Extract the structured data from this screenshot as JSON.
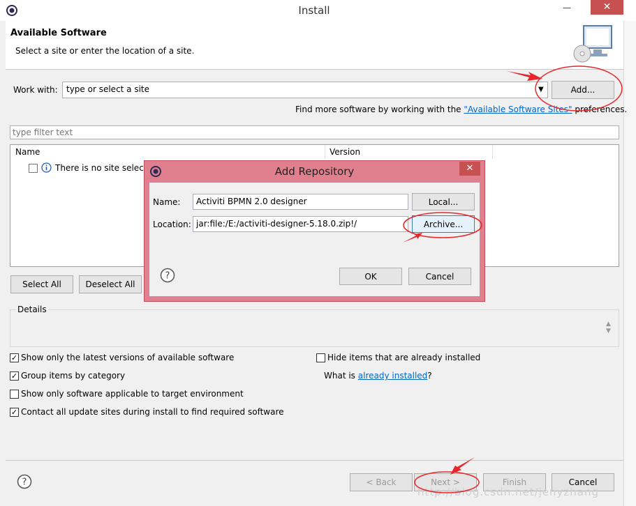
{
  "window": {
    "title": "Install",
    "minimize_glyph": "—",
    "close_glyph": "✕"
  },
  "header": {
    "title": "Available Software",
    "subtitle": "Select a site or enter the location of a site."
  },
  "work_with": {
    "label": "Work with:",
    "value": "type or select a site",
    "add_label": "Add..."
  },
  "find_more": {
    "prefix": "Find more software by working with the ",
    "link": "\"Available Software Sites\"",
    "suffix": " preferences."
  },
  "filter": {
    "placeholder": "type filter text"
  },
  "table": {
    "columns": [
      "Name",
      "Version"
    ],
    "rows": [
      {
        "text": "There is no site select"
      }
    ]
  },
  "buttons": {
    "select_all": "Select All",
    "deselect_all": "Deselect All",
    "back": "< Back",
    "next": "Next >",
    "finish": "Finish",
    "cancel": "Cancel"
  },
  "details": {
    "label": "Details"
  },
  "options": {
    "latest_versions": {
      "label": "Show only the latest versions of available software",
      "checked": true
    },
    "group_by_category": {
      "label": "Group items by category",
      "checked": true
    },
    "target_env": {
      "label": "Show only software applicable to target environment",
      "checked": false
    },
    "contact_sites": {
      "label": "Contact all update sites during install to find required software",
      "checked": true
    },
    "hide_installed": {
      "label": "Hide items that are already installed",
      "checked": false
    }
  },
  "what_is": {
    "prefix": "What is ",
    "link": "already installed",
    "suffix": "?"
  },
  "add_repository": {
    "title": "Add Repository",
    "name_label": "Name:",
    "name_value": "Activiti BPMN 2.0 designer",
    "local_label": "Local...",
    "location_label": "Location:",
    "location_value": "jar:file:/E:/activiti-designer-5.18.0.zip!/",
    "archive_label": "Archive...",
    "ok_label": "OK",
    "cancel_label": "Cancel",
    "close_glyph": "✕"
  },
  "watermark": "http://blog.csdn.net/jenyzhang",
  "colors": {
    "dialog_frame": "#e07f8e",
    "close_red": "#c75050",
    "link_blue": "#0066cc",
    "annotation_red": "#e8262a"
  }
}
